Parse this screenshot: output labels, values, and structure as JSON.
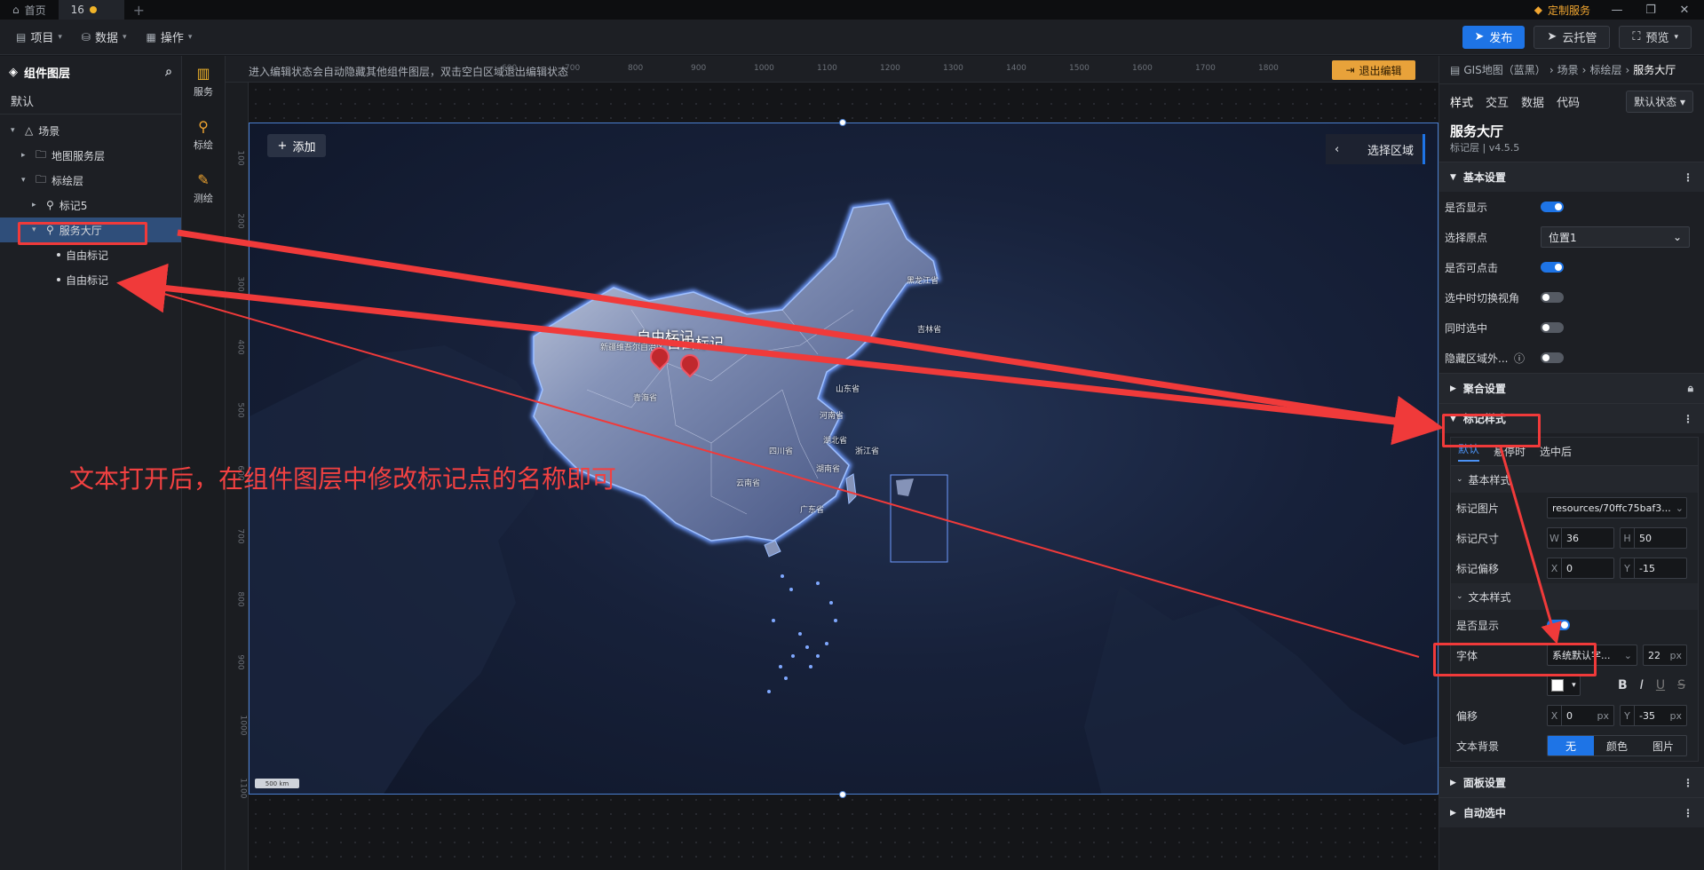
{
  "titlebar": {
    "tabs": [
      {
        "label": "首页",
        "icon": "home-icon"
      },
      {
        "label": "16",
        "modified": true
      }
    ],
    "custom_service": "定制服务"
  },
  "menubar": {
    "project": "项目",
    "data": "数据",
    "operate": "操作",
    "publish": "发布",
    "cloud": "云托管",
    "preview": "预览"
  },
  "layers": {
    "title": "组件图层",
    "tab_default": "默认",
    "tree": [
      {
        "label": "场景",
        "level": 0,
        "icon": "scene-icon",
        "expanded": true
      },
      {
        "label": "地图服务层",
        "level": 1,
        "icon": "folder-icon",
        "expanded": false
      },
      {
        "label": "标绘层",
        "level": 1,
        "icon": "folder-icon",
        "expanded": true
      },
      {
        "label": "标记5",
        "level": 2,
        "icon": "marker-layer-icon",
        "expanded": false
      },
      {
        "label": "服务大厅",
        "level": 2,
        "icon": "marker-layer-icon",
        "expanded": true,
        "selected": true
      },
      {
        "label": "自由标记",
        "level": 3,
        "icon": "bullet"
      },
      {
        "label": "自由标记",
        "level": 3,
        "icon": "bullet"
      }
    ]
  },
  "rail": [
    {
      "label": "服务",
      "icon": "map-icon"
    },
    {
      "label": "标绘",
      "icon": "pin-icon"
    },
    {
      "label": "测绘",
      "icon": "ruler-pen-icon"
    }
  ],
  "canvas": {
    "hint": "进入编辑状态会自动隐藏其他组件图层，双击空白区域退出编辑状态",
    "exit_edit": "退出编辑",
    "ruler_top": [
      "600",
      "700",
      "800",
      "900",
      "1000",
      "1100",
      "1200",
      "1300",
      "1400",
      "1500",
      "1600",
      "1700",
      "1800"
    ],
    "ruler_left": [
      "100",
      "200",
      "300",
      "400",
      "500",
      "600",
      "700",
      "800",
      "900",
      "1000",
      "1100"
    ],
    "add": "添加",
    "select_area": "选择区域",
    "marker_labels": [
      "自由标记",
      "自由标记"
    ],
    "scale": "500 km",
    "provinces": [
      "黑龙江省",
      "吉林省",
      "新疆维吾尔自治区",
      "青海省",
      "山东省",
      "河南省",
      "湖北省",
      "四川省",
      "浙江省",
      "湖南省",
      "云南省",
      "广东省"
    ]
  },
  "annotation": {
    "text": "文本打开后，在组件图层中修改标记点的名称即可",
    "color": "#f24141"
  },
  "props": {
    "breadcrumb": [
      "GIS地图（蓝黑）",
      "场景",
      "标绘层",
      "服务大厅"
    ],
    "tabs": [
      "样式",
      "交互",
      "数据",
      "代码"
    ],
    "state": "默认状态",
    "title": "服务大厅",
    "subtitle": "标记层 | v4.5.5",
    "basic_title": "基本设置",
    "basic": [
      {
        "label": "是否显示",
        "type": "toggle",
        "on": true
      },
      {
        "label": "选择原点",
        "type": "select",
        "value": "位置1"
      },
      {
        "label": "是否可点击",
        "type": "toggle",
        "on": true
      },
      {
        "label": "选中时切换视角",
        "type": "toggle",
        "on": false
      },
      {
        "label": "同时选中",
        "type": "toggle",
        "on": false
      },
      {
        "label": "隐藏区域外...",
        "type": "toggle",
        "on": false,
        "help": true
      }
    ],
    "cluster_title": "聚合设置",
    "marker_style_title": "标记样式",
    "style_tabs": [
      "默认",
      "悬停时",
      "选中后"
    ],
    "base_style_title": "基本样式",
    "marker_image_label": "标记图片",
    "marker_image_value": "resources/70ffc75baf3...",
    "marker_size_label": "标记尺寸",
    "marker_size_w": "36",
    "marker_size_h": "50",
    "marker_offset_label": "标记偏移",
    "marker_offset_x": "0",
    "marker_offset_y": "-15",
    "text_style_title": "文本样式",
    "text_show_label": "是否显示",
    "font_label": "字体",
    "font_value": "系统默认字...",
    "font_size": "22",
    "unit_px": "px",
    "text_color": "#ffffff",
    "offset_label": "偏移",
    "offset_x": "0",
    "offset_y": "-35",
    "text_bg_label": "文本背景",
    "text_bg_options": [
      "无",
      "颜色",
      "图片"
    ],
    "panel_title": "面板设置",
    "auto_select_title": "自动选中",
    "accent": "#1e74e6"
  }
}
